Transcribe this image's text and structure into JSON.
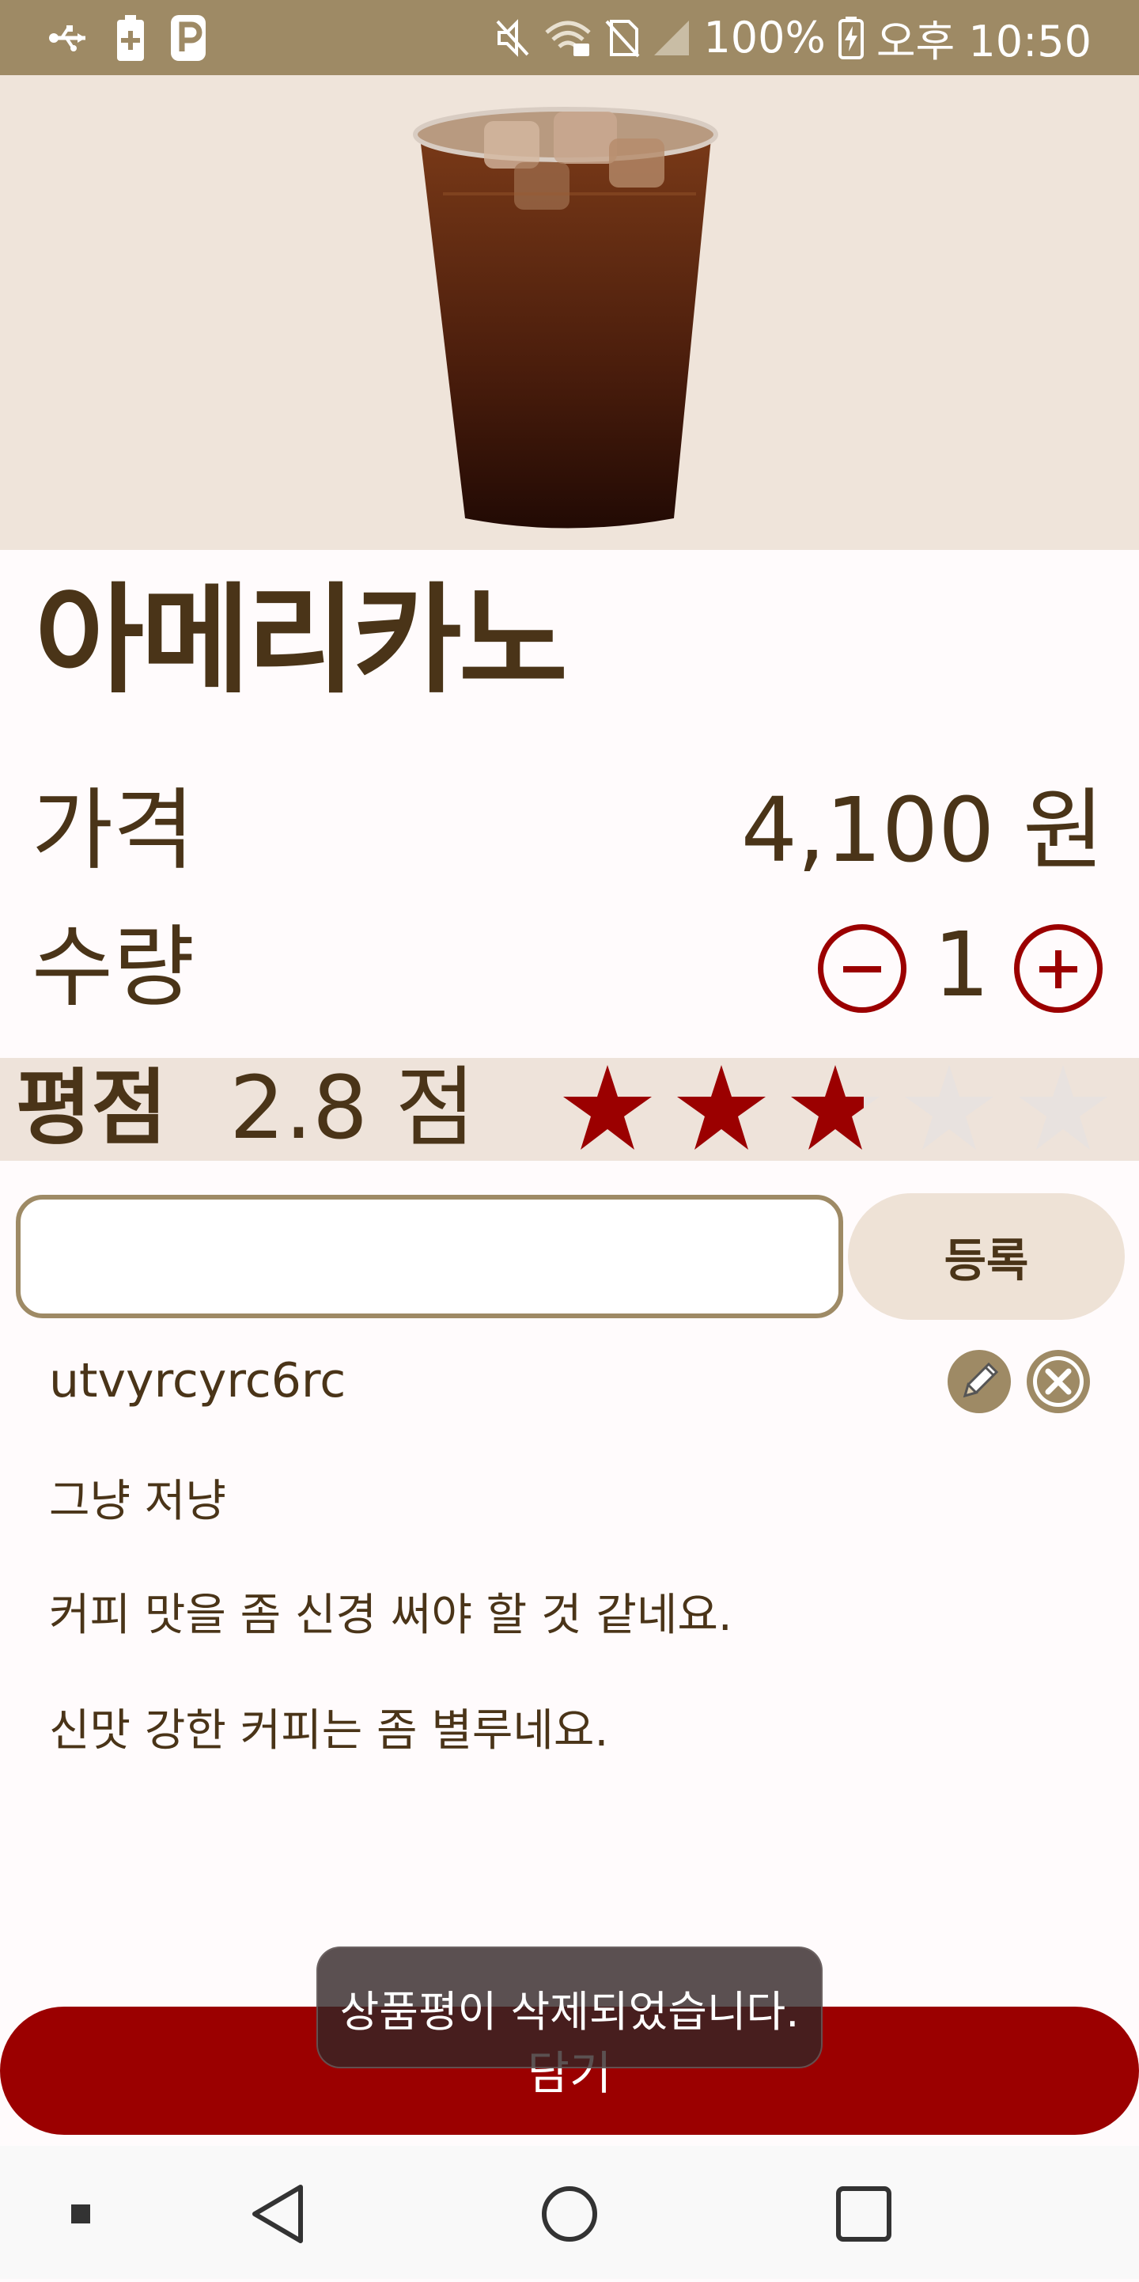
{
  "status_bar": {
    "battery": "100%",
    "time": "오후 10:50",
    "left_icons": [
      "usb-icon",
      "battery-plus-icon",
      "parking-icon"
    ],
    "right_icons": [
      "mute-icon",
      "wifi-icon",
      "no-sim-icon",
      "signal-icon",
      "battery-charging-icon"
    ]
  },
  "product": {
    "name": "아메리카노",
    "price_label": "가격",
    "price_value": "4,100 원",
    "quantity_label": "수량",
    "quantity": "1",
    "rating_label": "평점",
    "rating_text": "2.8 점",
    "rating": 2.8,
    "rating_max": 5
  },
  "review_form": {
    "input_value": "",
    "input_placeholder": "",
    "register_label": "등록"
  },
  "review": {
    "user": "utvyrcyrc6rc",
    "lines": [
      "그냥 저냥",
      "커피 맛을 좀 신경 써야 할 것 같네요.",
      "신맛 강한 커피는 좀 별루네요."
    ]
  },
  "cart_button_label": "담기",
  "toast": "상품평이 삭제되었습니다.",
  "colors": {
    "accent_red": "#9b0000",
    "brown_text": "#4a3418",
    "status_bar": "#9e8a65",
    "beige": "#efe4da",
    "star_empty": "#e8e2df"
  }
}
